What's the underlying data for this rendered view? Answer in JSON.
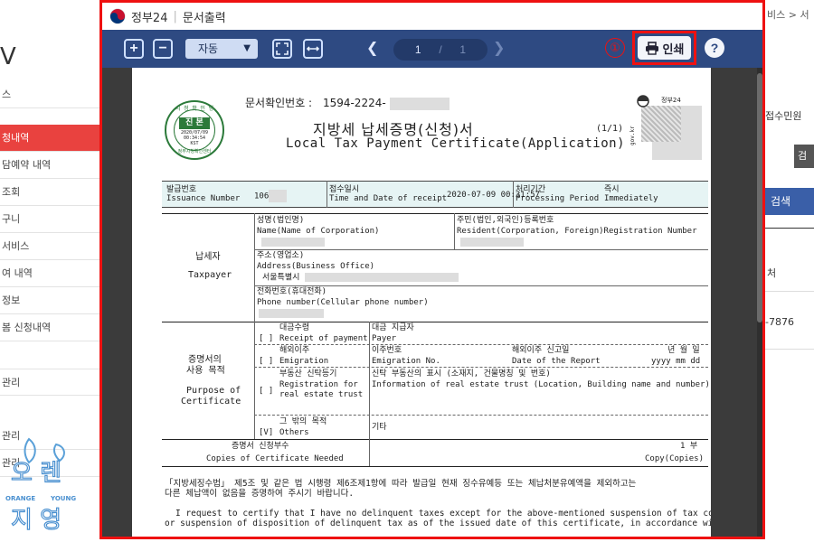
{
  "background": {
    "logo_text": "V",
    "sidebar": {
      "items_top": [
        "스",
        "청내역",
        "담예약 내역",
        "조회",
        "구니",
        "서비스",
        "여 내역",
        "정보",
        "봄 신청내역"
      ],
      "items_bottom": [
        "관리",
        "관리",
        "관리"
      ]
    },
    "right": {
      "breadcrumb": "비스 > 서",
      "label_civil": "접수민원",
      "gray_btn": "검",
      "search_btn": "검색",
      "col_head": "처",
      "value": "-7876"
    },
    "watermark": {
      "top": "오 렌",
      "mid_left": "ORANGE",
      "mid_right": "YOUNG",
      "bottom": "지 영"
    }
  },
  "modal": {
    "title_brand": "정부24",
    "title_sep": "|",
    "title_text": "문서출력",
    "toolbar": {
      "zoom_in": "+",
      "zoom_out": "−",
      "zoom_value": "자동",
      "page_current": "1",
      "page_sep": "/",
      "page_total": "1",
      "step_marker": "①",
      "print_label": "인쇄",
      "help_label": "?"
    }
  },
  "document": {
    "seal": {
      "top": "시 청 확 인 행",
      "main": "진 본",
      "date": "2020/07/09",
      "time": "00:34:54",
      "kst": "KST",
      "bottom": "정부시청확인센터"
    },
    "confirm_no_label": "문서확인번호 :",
    "confirm_no_value": "1594-2224-",
    "title_kr": "지방세 납세증명(신청)서",
    "title_en": "Local Tax Payment Certificate(Application)",
    "page_info": "(1/1)",
    "qr_label": "정부24",
    "qr_site": "gov.kr",
    "issue_row": {
      "issue_no_kr": "발급번호",
      "issue_no_en": "Issuance Number",
      "issue_no_value": "106",
      "receipt_kr": "접수일시",
      "receipt_en": "Time and Date of receipt",
      "receipt_value": "2020-07-09 00:31:57",
      "period_kr": "처리기간",
      "period_en": "Processing Period",
      "period_value_kr": "즉시",
      "period_value_en": "Immediately"
    },
    "taxpayer": {
      "label_kr": "납세자",
      "label_en": "Taxpayer",
      "name_kr": "성명(법인명)",
      "name_en": "Name(Name of Corporation)",
      "resident_kr": "주민(법인,외국인)등록번호",
      "resident_en": "Resident(Corporation, Foreign)Registration Number",
      "address_kr": "주소(영업소)",
      "address_en": "Address(Business Office)",
      "address_value": "서울특별시",
      "phone_kr": "전화번호(휴대전화)",
      "phone_en": "Phone number(Cellular phone number)"
    },
    "purpose": {
      "label_kr_1": "증명서의",
      "label_kr_2": "사용 목적",
      "label_en_1": "Purpose of",
      "label_en_2": "Certificate",
      "rows": [
        {
          "check": "[ ]",
          "kr": "대금수령",
          "en": "Receipt of payment",
          "detail_kr": "대금 지급자",
          "detail_en": "Payer"
        },
        {
          "check": "[ ]",
          "kr": "해외이주",
          "en": "Emigration",
          "detail_kr": "이주번호",
          "detail_en": "Emigration No.",
          "detail2_kr": "해외이주 신고일",
          "detail2_en": "Date of the Report",
          "ymd_kr": "년 월 일",
          "ymd_en": "yyyy  mm  dd"
        },
        {
          "check": "[ ]",
          "kr": "부동산 신탁등기",
          "en1": "Registration for",
          "en2": "real estate trust",
          "detail_kr": "신탁 부동산의 표시 (소재지, 건물명칭 및 번호)",
          "detail_en": "Information of real estate trust (Location, Building name and number)"
        },
        {
          "check": "[V]",
          "kr": "그 밖의 목적",
          "en": "Others",
          "detail_kr": "기타"
        }
      ]
    },
    "copies": {
      "label_kr": "증명서 신청부수",
      "label_en": "Copies of Certificate Needed",
      "value_kr": "1 부",
      "value_en": "Copy(Copies)"
    },
    "notes": [
      "「지방세징수법」 제5조 및 같은 법 시행령 제6조제1항에 따라 발급일 현재 징수유예등 또는 체납처분유예액을 제외하고는",
      "다른 체납액이 없음을 증명하여 주시기 바랍니다.",
      "I request to certify that I have no delinquent taxes except for the above-mentioned suspension of tax collection",
      "or suspension of disposition of delinquent tax as of the issued date of this certificate, in accordance with the"
    ]
  }
}
